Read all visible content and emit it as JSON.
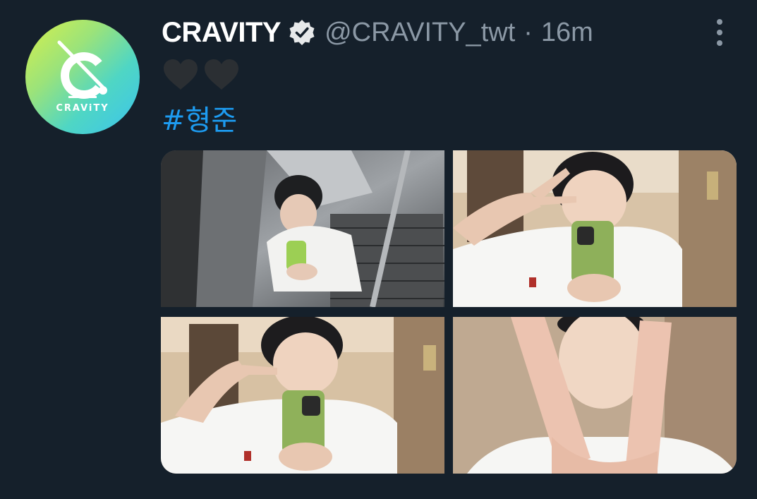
{
  "tweet": {
    "display_name": "CRAVITY",
    "handle": "@CRAVITY_twt",
    "separator": "·",
    "time": "16m",
    "verified": true,
    "hearts": [
      "black-heart",
      "black-heart"
    ],
    "hashtag": "#형준"
  },
  "avatar": {
    "wordmark": "CRAViTY",
    "colors": [
      "#d8f04a",
      "#4fd6c4",
      "#3bc4ee"
    ]
  },
  "media": {
    "photos": [
      {
        "name": "mirror selfie in elevator"
      },
      {
        "name": "peace sign selfie"
      },
      {
        "name": "cheek point selfie"
      },
      {
        "name": "close-up peace sign"
      }
    ]
  },
  "colors": {
    "background": "#15202b",
    "text_primary": "#ffffff",
    "text_secondary": "#8b98a5",
    "link": "#1d9bf0"
  },
  "icons": {
    "verified": "verified-badge-icon",
    "more": "more-vertical-icon"
  }
}
